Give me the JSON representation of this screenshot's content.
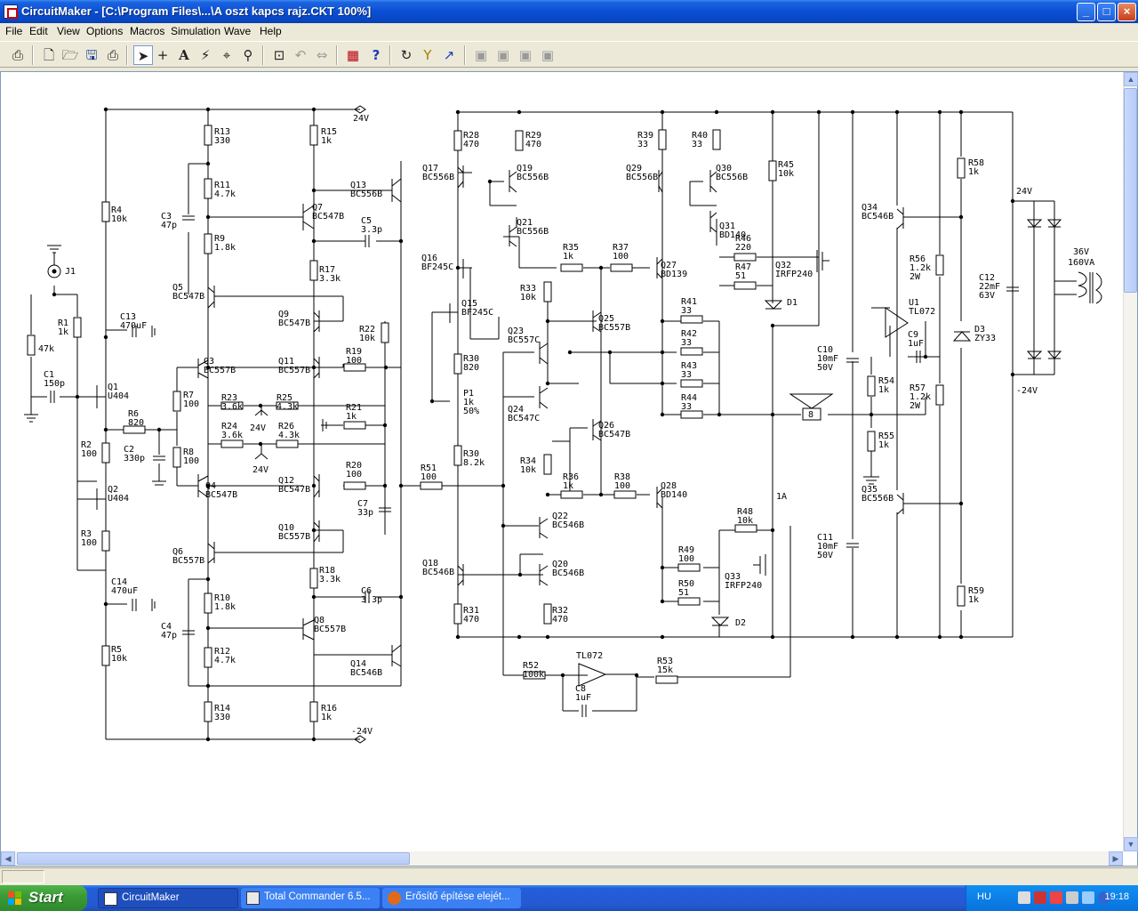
{
  "window": {
    "title": "CircuitMaker - [C:\\Program Files\\...\\A oszt kapcs rajz.CKT 100%]",
    "buttons": {
      "minimize": "_",
      "maximize": "□",
      "close": "×"
    }
  },
  "menu": [
    "File",
    "Edit",
    "View",
    "Options",
    "Macros",
    "Simulation",
    "Wave",
    "Help"
  ],
  "toolbar": {
    "icons": [
      "print-setup-icon",
      "new-file-icon",
      "open-folder-icon",
      "save-icon",
      "print-icon",
      "arrow-pointer-icon",
      "wire-cross-icon",
      "text-tool-icon",
      "probe-lightning-icon",
      "probe-icon",
      "zoom-icon",
      "zoom-fit-icon",
      "rotate-icon",
      "mirror-icon",
      "netlist-icon",
      "help-icon",
      "undo-icon",
      "trace-icon",
      "step-icon",
      "grid-1-icon",
      "grid-2-icon",
      "grid-3-icon",
      "grid-4-icon"
    ]
  },
  "schematic": {
    "supply_labels": [
      "24V",
      "-24V",
      "24V",
      "-24V",
      "24V",
      "-24V"
    ],
    "components": [
      {
        "ref": "R13",
        "val": "330"
      },
      {
        "ref": "R15",
        "val": "1k"
      },
      {
        "ref": "R11",
        "val": "4.7k"
      },
      {
        "ref": "R9",
        "val": "1.8k"
      },
      {
        "ref": "C3",
        "val": "47p"
      },
      {
        "ref": "R4",
        "val": "10k"
      },
      {
        "ref": "Q7",
        "val": "BC547B"
      },
      {
        "ref": "C5",
        "val": "3.3p"
      },
      {
        "ref": "Q13",
        "val": "BC556B"
      },
      {
        "ref": "R17",
        "val": "3.3k"
      },
      {
        "ref": "Q5",
        "val": "BC547B"
      },
      {
        "ref": "Q9",
        "val": "BC547B"
      },
      {
        "ref": "C13",
        "val": "470uF"
      },
      {
        "ref": "R1",
        "val": "1k"
      },
      {
        "ref": "R22",
        "val": "10k"
      },
      {
        "ref": "Q3",
        "val": "BC557B"
      },
      {
        "ref": "Q11",
        "val": "BC557B"
      },
      {
        "ref": "R19",
        "val": "100"
      },
      {
        "ref": "C1",
        "val": "150p"
      },
      {
        "ref": "Q1",
        "val": "U404"
      },
      {
        "ref": "R7",
        "val": "100"
      },
      {
        "ref": "R23",
        "val": "3.6k"
      },
      {
        "ref": "R25",
        "val": "4.3k"
      },
      {
        "ref": "R21",
        "val": "1k"
      },
      {
        "ref": "R6",
        "val": "820"
      },
      {
        "ref": "R24",
        "val": "3.6k"
      },
      {
        "ref": "R26",
        "val": "4.3k"
      },
      {
        "ref": "R2",
        "val": "100"
      },
      {
        "ref": "C2",
        "val": "330p"
      },
      {
        "ref": "R8",
        "val": "100"
      },
      {
        "ref": "Q4",
        "val": "BC547B"
      },
      {
        "ref": "Q12",
        "val": "BC547B"
      },
      {
        "ref": "R20",
        "val": "100"
      },
      {
        "ref": "Q2",
        "val": "U404"
      },
      {
        "ref": "C7",
        "val": "33p"
      },
      {
        "ref": "R3",
        "val": "100"
      },
      {
        "ref": "Q10",
        "val": "BC557B"
      },
      {
        "ref": "Q6",
        "val": "BC557B"
      },
      {
        "ref": "R18",
        "val": "3.3k"
      },
      {
        "ref": "C14",
        "val": "470uF"
      },
      {
        "ref": "C6",
        "val": "3.3p"
      },
      {
        "ref": "R10",
        "val": "1.8k"
      },
      {
        "ref": "C4",
        "val": "47p"
      },
      {
        "ref": "Q8",
        "val": "BC557B"
      },
      {
        "ref": "R5",
        "val": "10k"
      },
      {
        "ref": "R12",
        "val": "4.7k"
      },
      {
        "ref": "Q14",
        "val": "BC546B"
      },
      {
        "ref": "R14",
        "val": "330"
      },
      {
        "ref": "R16",
        "val": "1k"
      },
      {
        "ref": "R28",
        "val": "470"
      },
      {
        "ref": "R29",
        "val": "470"
      },
      {
        "ref": "Q17",
        "val": "BC556B"
      },
      {
        "ref": "Q19",
        "val": "BC556B"
      },
      {
        "ref": "Q21",
        "val": "BC556B"
      },
      {
        "ref": "Q16",
        "val": "BF245C"
      },
      {
        "ref": "R35",
        "val": "1k"
      },
      {
        "ref": "R37",
        "val": "100"
      },
      {
        "ref": "Q15",
        "val": "BF245C"
      },
      {
        "ref": "R33",
        "val": "10k"
      },
      {
        "ref": "R30",
        "val": "820"
      },
      {
        "ref": "P1",
        "val": "1k 50%"
      },
      {
        "ref": "R30",
        "val": "8.2k"
      },
      {
        "ref": "Q23",
        "val": "BC557C"
      },
      {
        "ref": "Q25",
        "val": "BC557B"
      },
      {
        "ref": "Q24",
        "val": "BC547C"
      },
      {
        "ref": "Q26",
        "val": "BC547B"
      },
      {
        "ref": "R34",
        "val": "10k"
      },
      {
        "ref": "R51",
        "val": "100"
      },
      {
        "ref": "R36",
        "val": "1k"
      },
      {
        "ref": "R38",
        "val": "100"
      },
      {
        "ref": "Q22",
        "val": "BC546B"
      },
      {
        "ref": "Q18",
        "val": "BC546B"
      },
      {
        "ref": "Q20",
        "val": "BC546B"
      },
      {
        "ref": "R31",
        "val": "470"
      },
      {
        "ref": "R32",
        "val": "470"
      },
      {
        "ref": "R39",
        "val": "33"
      },
      {
        "ref": "R40",
        "val": "33"
      },
      {
        "ref": "Q29",
        "val": "BC556B"
      },
      {
        "ref": "Q30",
        "val": "BC556B"
      },
      {
        "ref": "Q31",
        "val": "BD140"
      },
      {
        "ref": "R46",
        "val": "220"
      },
      {
        "ref": "Q27",
        "val": "BD139"
      },
      {
        "ref": "R47",
        "val": "51"
      },
      {
        "ref": "R41",
        "val": "33"
      },
      {
        "ref": "R42",
        "val": "33"
      },
      {
        "ref": "R43",
        "val": "33"
      },
      {
        "ref": "R44",
        "val": "33"
      },
      {
        "ref": "Q28",
        "val": "BD140"
      },
      {
        "ref": "R48",
        "val": "10k"
      },
      {
        "ref": "R49",
        "val": "100"
      },
      {
        "ref": "R50",
        "val": "51"
      },
      {
        "ref": "R45",
        "val": "10k"
      },
      {
        "ref": "Q32",
        "val": "IRFP240"
      },
      {
        "ref": "Q33",
        "val": "IRFP240"
      },
      {
        "ref": "R52",
        "val": "100k"
      },
      {
        "ref": "R53",
        "val": "15k"
      },
      {
        "ref": "C8",
        "val": "1uF"
      },
      {
        "ref": "C10",
        "val": "10mF 50V"
      },
      {
        "ref": "C11",
        "val": "10mF 50V"
      },
      {
        "ref": "Q34",
        "val": "BC546B"
      },
      {
        "ref": "U1",
        "val": "TL072"
      },
      {
        "ref": "C9",
        "val": "1uF"
      },
      {
        "ref": "R54",
        "val": "1k"
      },
      {
        "ref": "R55",
        "val": "1k"
      },
      {
        "ref": "Q35",
        "val": "BC556B"
      },
      {
        "ref": "R56",
        "val": "1.2k 2W"
      },
      {
        "ref": "R57",
        "val": "1.2k 2W"
      },
      {
        "ref": "R58",
        "val": "1k"
      },
      {
        "ref": "R59",
        "val": "1k"
      },
      {
        "ref": "D3",
        "val": "ZY33"
      },
      {
        "ref": "C12",
        "val": "22mF 63V"
      }
    ],
    "misc_labels": {
      "j1": "J1",
      "r47k": "47k",
      "d1": "D1",
      "d2": "D2",
      "speaker": "8",
      "fuse": "1A",
      "tl072": "TL072",
      "transformer": "36V 160VA",
      "rail_pos": "24V",
      "rail_neg": "-24V"
    }
  },
  "taskbar": {
    "start": "Start",
    "tasks": [
      "CircuitMaker",
      "Total Commander 6.5...",
      "Erősítő építése elejét..."
    ],
    "tray": {
      "lang": "HU",
      "clock": "19:18"
    }
  },
  "colors": {
    "titlebar": "#0a4fd4",
    "taskbar": "#245edb",
    "start": "#3c9b36",
    "wire": "#000000",
    "canvas": "#ffffff"
  }
}
